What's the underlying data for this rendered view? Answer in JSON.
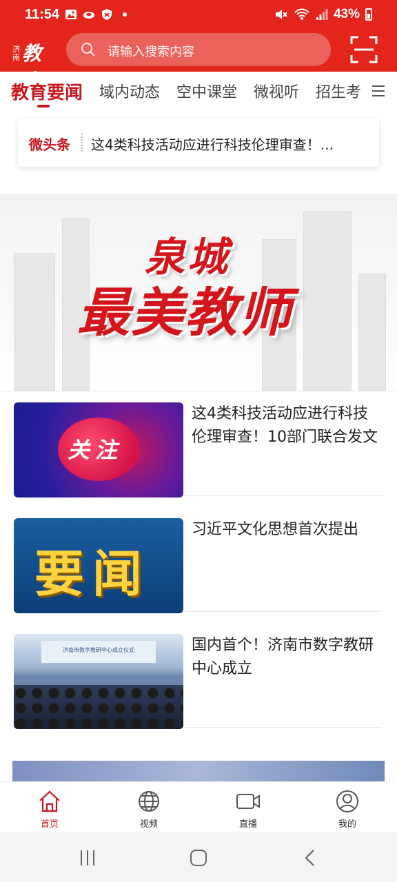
{
  "status_bar": {
    "time": "11:54",
    "battery": "43%",
    "left_icons": [
      "image-icon",
      "cloud-icon",
      "shield-icon",
      "dot-icon"
    ],
    "right_icons": [
      "mute-icon",
      "wifi-icon",
      "signal-icon",
      "battery-icon"
    ]
  },
  "header": {
    "logo_small": "济南",
    "logo_big": "教育",
    "search_placeholder": "请输入搜索内容"
  },
  "tabs": [
    {
      "label": "教育要闻",
      "active": true
    },
    {
      "label": "域内动态",
      "active": false
    },
    {
      "label": "空中课堂",
      "active": false
    },
    {
      "label": "微视听",
      "active": false
    },
    {
      "label": "招生考",
      "active": false
    }
  ],
  "headline": {
    "label": "微头条",
    "text": "这4类科技活动应进行科技伦理审查！..."
  },
  "banner": {
    "line1": "泉城",
    "line2": "最美教师"
  },
  "news": [
    {
      "thumb_label": "关注",
      "title": "这4类科技活动应进行科技伦理审查！10部门联合发文"
    },
    {
      "thumb_label": "要闻",
      "title": "习近平文化思想首次提出"
    },
    {
      "thumb_label": "济南市数字教研中心成立仪式",
      "title": "国内首个！济南市数字教研中心成立"
    }
  ],
  "bottom_nav": [
    {
      "label": "首页",
      "icon": "home-icon",
      "active": true
    },
    {
      "label": "视频",
      "icon": "globe-icon",
      "active": false
    },
    {
      "label": "直播",
      "icon": "camera-icon",
      "active": false
    },
    {
      "label": "我的",
      "icon": "user-icon",
      "active": false
    }
  ],
  "colors": {
    "brand_red": "#e4251c",
    "accent_red": "#c8161d"
  }
}
